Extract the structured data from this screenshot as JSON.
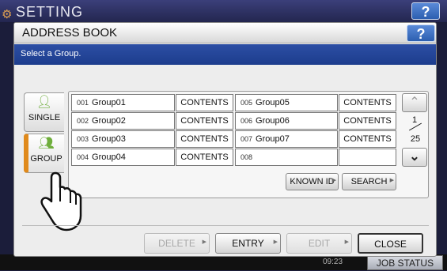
{
  "background": {
    "title": "SETTING",
    "help_label": "?",
    "time": "09:23",
    "job_status_label": "JOB STATUS"
  },
  "dialog": {
    "title": "ADDRESS BOOK",
    "help_label": "?",
    "message": "Select a Group."
  },
  "tabs": {
    "single": {
      "label": "SINGLE",
      "icon": "person-icon"
    },
    "group": {
      "label": "GROUP",
      "icon": "group-icon",
      "selected": true
    }
  },
  "groups": [
    {
      "num": "001",
      "name": "Group01",
      "contents": "CONTENTS"
    },
    {
      "num": "002",
      "name": "Group02",
      "contents": "CONTENTS"
    },
    {
      "num": "003",
      "name": "Group03",
      "contents": "CONTENTS"
    },
    {
      "num": "004",
      "name": "Group04",
      "contents": "CONTENTS"
    },
    {
      "num": "005",
      "name": "Group05",
      "contents": "CONTENTS"
    },
    {
      "num": "006",
      "name": "Group06",
      "contents": "CONTENTS"
    },
    {
      "num": "007",
      "name": "Group07",
      "contents": "CONTENTS"
    },
    {
      "num": "008",
      "name": "",
      "contents": ""
    }
  ],
  "pager": {
    "current": "1",
    "total": "25"
  },
  "search": {
    "known_id_label": "KNOWN ID",
    "search_label": "SEARCH"
  },
  "actions": {
    "delete_label": "DELETE",
    "entry_label": "ENTRY",
    "edit_label": "EDIT",
    "close_label": "CLOSE"
  },
  "colors": {
    "message_bar": "#1d3d8d",
    "group_tab_accent": "#e08a1c",
    "help_button": "#2c5fb0"
  }
}
